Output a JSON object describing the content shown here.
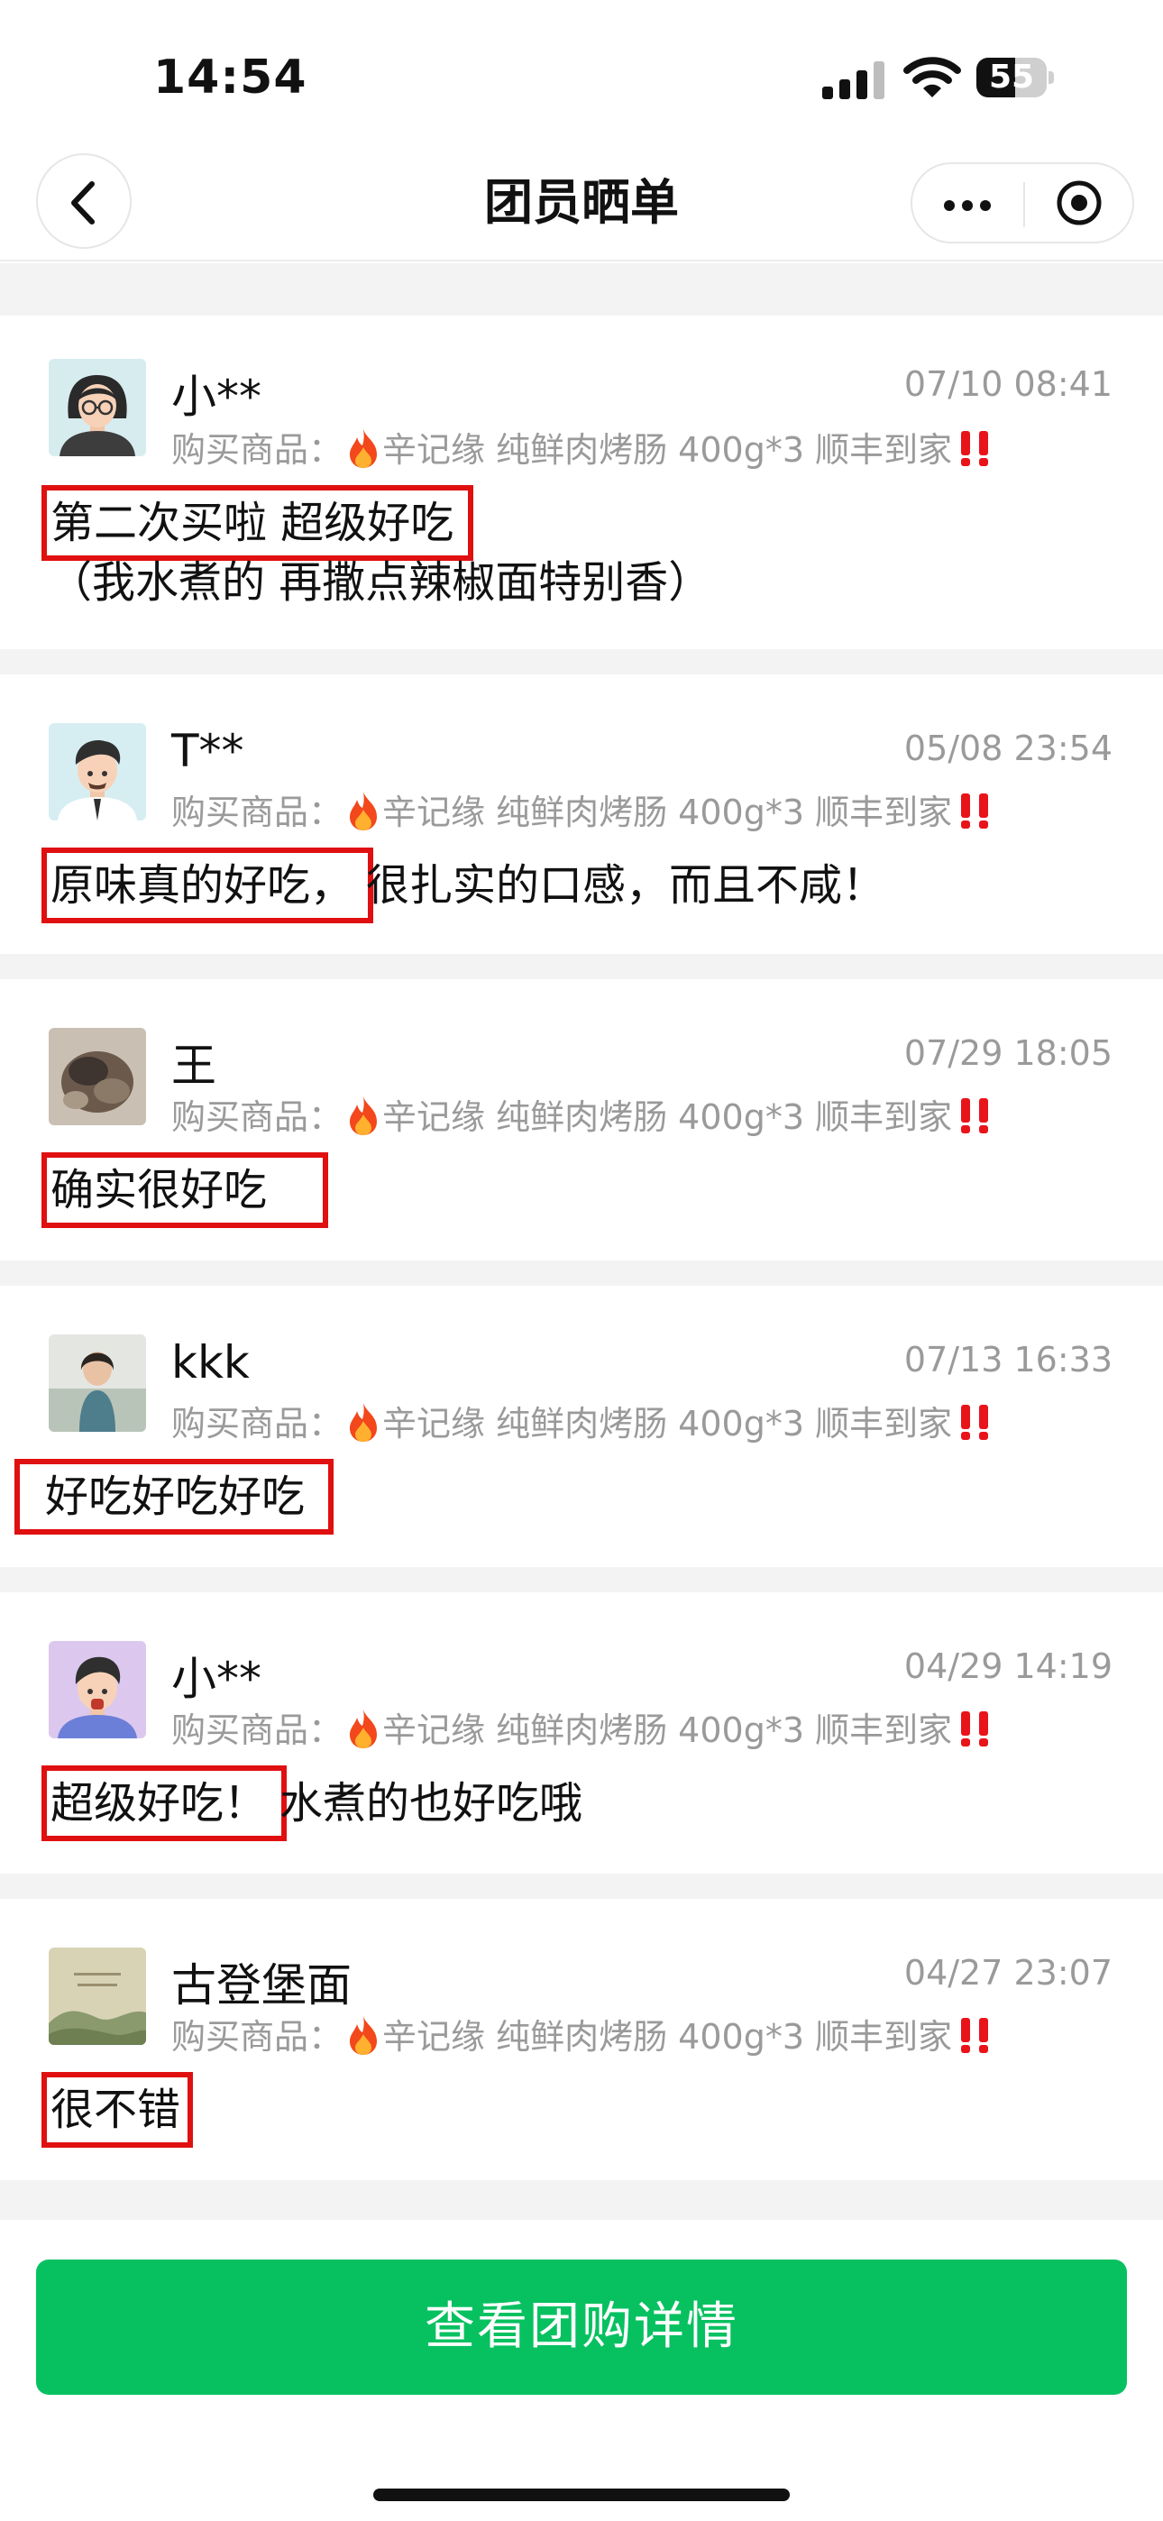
{
  "status_bar": {
    "time": "14:54",
    "battery": "55",
    "battery_level": 0.55,
    "icons": [
      "cellular-signal-icon",
      "wifi-icon",
      "battery-icon"
    ]
  },
  "nav": {
    "title": "团员晒单",
    "icons": [
      "chevron-left-icon",
      "more-dots-icon",
      "close-target-icon"
    ]
  },
  "product_prefix": "购买商品：",
  "product_name": "辛记缘 纯鲜肉烤肠 400g*3 顺丰到家",
  "product_icons": [
    "fire-emoji-icon",
    "double-exclamation-icon"
  ],
  "highlight_color": "#e01010",
  "accent_color": "#07c160",
  "reviews": [
    {
      "name": "小**",
      "date": "07/10 08:41",
      "highlight": "第二次买啦 超级好吃",
      "rest": "（我水煮的 再撒点辣椒面特别香）",
      "avatar": "illustrated-woman-avatar"
    },
    {
      "name": "T**",
      "date": "05/08 23:54",
      "highlight": "原味真的好吃，",
      "rest": "很扎实的口感，而且不咸！",
      "avatar": "illustrated-man-avatar"
    },
    {
      "name": "王",
      "date": "07/29 18:05",
      "highlight": "确实很好吃",
      "rest": "",
      "avatar": "photo-avatar"
    },
    {
      "name": "kkk",
      "date": "07/13 16:33",
      "highlight": "好吃好吃好吃",
      "rest": "",
      "avatar": "photo-avatar"
    },
    {
      "name": "小**",
      "date": "04/29 14:19",
      "highlight": "超级好吃！",
      "rest": "水煮的也好吃哦",
      "avatar": "illustrated-man-avatar"
    },
    {
      "name": "古登堡面",
      "date": "04/27 23:07",
      "highlight": "很不错",
      "rest": "",
      "avatar": "landscape-painting-avatar"
    }
  ],
  "cta": {
    "label": "查看团购详情"
  }
}
